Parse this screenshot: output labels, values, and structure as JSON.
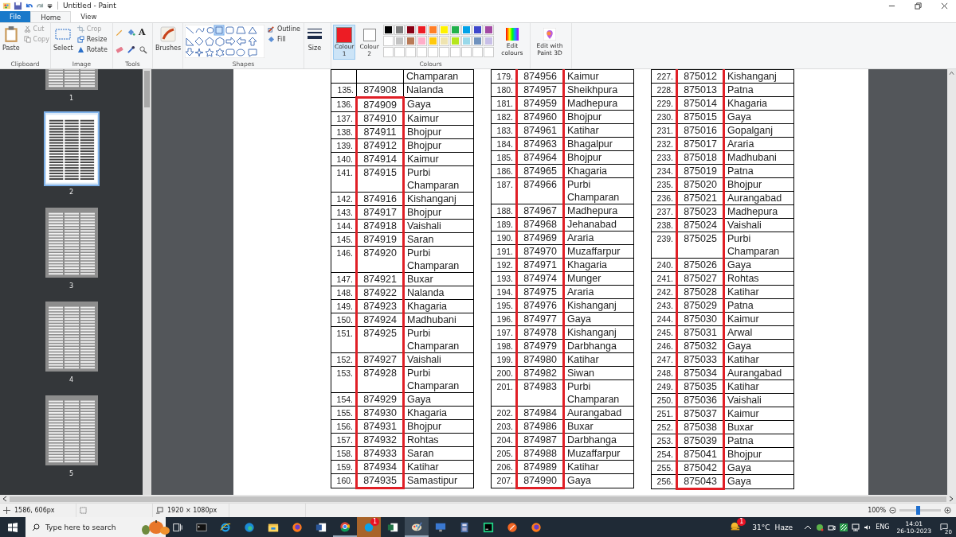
{
  "window": {
    "title": "Untitled - Paint"
  },
  "tabs": [
    {
      "label": "File",
      "selected": false,
      "kind": "file"
    },
    {
      "label": "Home",
      "selected": true,
      "kind": "tab"
    },
    {
      "label": "View",
      "selected": false,
      "kind": "tab"
    }
  ],
  "ribbon": {
    "clipboard": {
      "label": "Clipboard",
      "paste": "Paste",
      "small": [
        {
          "label": "Cut",
          "kind": "cut",
          "disabled": true
        },
        {
          "label": "Copy",
          "kind": "copy",
          "disabled": true
        }
      ]
    },
    "image": {
      "label": "Image",
      "select": "Select",
      "small": [
        {
          "label": "Crop",
          "kind": "crop",
          "disabled": true
        },
        {
          "label": "Resize",
          "kind": "resize",
          "disabled": false
        },
        {
          "label": "Rotate",
          "kind": "rotate",
          "disabled": false
        }
      ]
    },
    "tools": {
      "label": "Tools",
      "text_tool": "A"
    },
    "brushes": "Brushes",
    "shapes": {
      "label": "Shapes",
      "outline": "Outline",
      "fill": "Fill"
    },
    "size": "Size",
    "colours": {
      "label": "Colours",
      "colour1": {
        "label": "Colour 1",
        "color": "#ed1c24",
        "selected": true
      },
      "colour2": {
        "label": "Colour 2",
        "color": "#ffffff",
        "selected": false
      },
      "palette": [
        {
          "color": "#000000"
        },
        {
          "color": "#7f7f7f"
        },
        {
          "color": "#880015"
        },
        {
          "color": "#ed1c24"
        },
        {
          "color": "#ff7f27"
        },
        {
          "color": "#fff200"
        },
        {
          "color": "#22b14c"
        },
        {
          "color": "#00a2e8"
        },
        {
          "color": "#3f48cc"
        },
        {
          "color": "#a349a4"
        },
        {
          "color": "#ffffff"
        },
        {
          "color": "#c3c3c3"
        },
        {
          "color": "#b97a57"
        },
        {
          "color": "#ffaec9"
        },
        {
          "color": "#ffc90e"
        },
        {
          "color": "#efe4b0"
        },
        {
          "color": "#b5e61d"
        },
        {
          "color": "#99d9ea"
        },
        {
          "color": "#7092be"
        },
        {
          "color": "#c8bfe7"
        }
      ],
      "edit": "Edit colours"
    },
    "paint3d": "Edit with Paint 3D"
  },
  "thumbnails": [
    {
      "label": "1",
      "selected": false
    },
    {
      "label": "2",
      "selected": true
    },
    {
      "label": "3",
      "selected": false
    },
    {
      "label": "4",
      "selected": false
    },
    {
      "label": "5",
      "selected": false
    }
  ],
  "tables": [
    {
      "rows": [
        {
          "district": "Champaran",
          "marked": false
        },
        {
          "num": "135.",
          "pin": "874908",
          "district": "Nalanda",
          "marked": false
        },
        {
          "num": "136.",
          "pin": "874909",
          "district": "Gaya",
          "marked": true
        },
        {
          "num": "137.",
          "pin": "874910",
          "district": "Kaimur",
          "marked": true
        },
        {
          "num": "138.",
          "pin": "874911",
          "district": "Bhojpur",
          "marked": true
        },
        {
          "num": "139.",
          "pin": "874912",
          "district": "Bhojpur",
          "marked": true
        },
        {
          "num": "140.",
          "pin": "874914",
          "district": "Kaimur",
          "marked": true
        },
        {
          "num": "141.",
          "pin": "874915",
          "district": "Purbi Champaran",
          "marked": true
        },
        {
          "num": "142.",
          "pin": "874916",
          "district": "Kishanganj",
          "marked": true
        },
        {
          "num": "143.",
          "pin": "874917",
          "district": "Bhojpur",
          "marked": true
        },
        {
          "num": "144.",
          "pin": "874918",
          "district": "Vaishali",
          "marked": true
        },
        {
          "num": "145.",
          "pin": "874919",
          "district": "Saran",
          "marked": true
        },
        {
          "num": "146.",
          "pin": "874920",
          "district": "Purbi Champaran",
          "marked": true
        },
        {
          "num": "147.",
          "pin": "874921",
          "district": "Buxar",
          "marked": true
        },
        {
          "num": "148.",
          "pin": "874922",
          "district": "Nalanda",
          "marked": true
        },
        {
          "num": "149.",
          "pin": "874923",
          "district": "Khagaria",
          "marked": true
        },
        {
          "num": "150.",
          "pin": "874924",
          "district": "Madhubani",
          "marked": true
        },
        {
          "num": "151.",
          "pin": "874925",
          "district": "Purbi Champaran",
          "marked": true
        },
        {
          "num": "152.",
          "pin": "874927",
          "district": "Vaishali",
          "marked": true
        },
        {
          "num": "153.",
          "pin": "874928",
          "district": "Purbi Champaran",
          "marked": true
        },
        {
          "num": "154.",
          "pin": "874929",
          "district": "Gaya",
          "marked": true
        },
        {
          "num": "155.",
          "pin": "874930",
          "district": "Khagaria",
          "marked": true
        },
        {
          "num": "156.",
          "pin": "874931",
          "district": "Bhojpur",
          "marked": true
        },
        {
          "num": "157.",
          "pin": "874932",
          "district": "Rohtas",
          "marked": true
        },
        {
          "num": "158.",
          "pin": "874933",
          "district": "Saran",
          "marked": true
        },
        {
          "num": "159.",
          "pin": "874934",
          "district": "Katihar",
          "marked": true
        },
        {
          "num": "160.",
          "pin": "874935",
          "district": "Samastipur",
          "marked": true
        }
      ]
    },
    {
      "rows": [
        {
          "num": "179.",
          "pin": "874956",
          "district": "Kaimur",
          "marked": true
        },
        {
          "num": "180.",
          "pin": "874957",
          "district": "Sheikhpura",
          "marked": true
        },
        {
          "num": "181.",
          "pin": "874959",
          "district": "Madhepura",
          "marked": true
        },
        {
          "num": "182.",
          "pin": "874960",
          "district": "Bhojpur",
          "marked": true
        },
        {
          "num": "183.",
          "pin": "874961",
          "district": "Katihar",
          "marked": true
        },
        {
          "num": "184.",
          "pin": "874963",
          "district": "Bhagalpur",
          "marked": true
        },
        {
          "num": "185.",
          "pin": "874964",
          "district": "Bhojpur",
          "marked": true
        },
        {
          "num": "186.",
          "pin": "874965",
          "district": "Khagaria",
          "marked": true
        },
        {
          "num": "187.",
          "pin": "874966",
          "district": "Purbi Champaran",
          "marked": true
        },
        {
          "num": "188.",
          "pin": "874967",
          "district": "Madhepura",
          "marked": true
        },
        {
          "num": "189.",
          "pin": "874968",
          "district": "Jehanabad",
          "marked": true
        },
        {
          "num": "190.",
          "pin": "874969",
          "district": "Araria",
          "marked": true
        },
        {
          "num": "191.",
          "pin": "874970",
          "district": "Muzaffarpur",
          "marked": true
        },
        {
          "num": "192.",
          "pin": "874971",
          "district": "Khagaria",
          "marked": true
        },
        {
          "num": "193.",
          "pin": "874974",
          "district": "Munger",
          "marked": true
        },
        {
          "num": "194.",
          "pin": "874975",
          "district": "Araria",
          "marked": true
        },
        {
          "num": "195.",
          "pin": "874976",
          "district": "Kishanganj",
          "marked": true
        },
        {
          "num": "196.",
          "pin": "874977",
          "district": "Gaya",
          "marked": true
        },
        {
          "num": "197.",
          "pin": "874978",
          "district": "Kishanganj",
          "marked": true
        },
        {
          "num": "198.",
          "pin": "874979",
          "district": "Darbhanga",
          "marked": true
        },
        {
          "num": "199.",
          "pin": "874980",
          "district": "Katihar",
          "marked": true
        },
        {
          "num": "200.",
          "pin": "874982",
          "district": "Siwan",
          "marked": true
        },
        {
          "num": "201.",
          "pin": "874983",
          "district": "Purbi Champaran",
          "marked": true
        },
        {
          "num": "202.",
          "pin": "874984",
          "district": "Aurangabad",
          "marked": true
        },
        {
          "num": "203.",
          "pin": "874986",
          "district": "Buxar",
          "marked": true
        },
        {
          "num": "204.",
          "pin": "874987",
          "district": "Darbhanga",
          "marked": true
        },
        {
          "num": "205.",
          "pin": "874988",
          "district": "Muzaffarpur",
          "marked": true
        },
        {
          "num": "206.",
          "pin": "874989",
          "district": "Katihar",
          "marked": true
        },
        {
          "num": "207.",
          "pin": "874990",
          "district": "Gaya",
          "marked": true
        }
      ]
    },
    {
      "rows": [
        {
          "num": "227.",
          "pin": "875012",
          "district": "Kishanganj",
          "marked": true
        },
        {
          "num": "228.",
          "pin": "875013",
          "district": "Patna",
          "marked": true
        },
        {
          "num": "229.",
          "pin": "875014",
          "district": "Khagaria",
          "marked": true
        },
        {
          "num": "230.",
          "pin": "875015",
          "district": "Gaya",
          "marked": true
        },
        {
          "num": "231.",
          "pin": "875016",
          "district": "Gopalganj",
          "marked": true
        },
        {
          "num": "232.",
          "pin": "875017",
          "district": "Araria",
          "marked": true
        },
        {
          "num": "233.",
          "pin": "875018",
          "district": "Madhubani",
          "marked": true
        },
        {
          "num": "234.",
          "pin": "875019",
          "district": "Patna",
          "marked": true
        },
        {
          "num": "235.",
          "pin": "875020",
          "district": "Bhojpur",
          "marked": true
        },
        {
          "num": "236.",
          "pin": "875021",
          "district": "Aurangabad",
          "marked": true
        },
        {
          "num": "237.",
          "pin": "875023",
          "district": "Madhepura",
          "marked": true
        },
        {
          "num": "238.",
          "pin": "875024",
          "district": "Vaishali",
          "marked": true
        },
        {
          "num": "239.",
          "pin": "875025",
          "district": "Purbi Champaran",
          "marked": true
        },
        {
          "num": "240.",
          "pin": "875026",
          "district": "Gaya",
          "marked": true
        },
        {
          "num": "241.",
          "pin": "875027",
          "district": "Rohtas",
          "marked": true
        },
        {
          "num": "242.",
          "pin": "875028",
          "district": "Katihar",
          "marked": true
        },
        {
          "num": "243.",
          "pin": "875029",
          "district": "Patna",
          "marked": true
        },
        {
          "num": "244.",
          "pin": "875030",
          "district": "Kaimur",
          "marked": true
        },
        {
          "num": "245.",
          "pin": "875031",
          "district": "Arwal",
          "marked": true
        },
        {
          "num": "246.",
          "pin": "875032",
          "district": "Gaya",
          "marked": true
        },
        {
          "num": "247.",
          "pin": "875033",
          "district": "Katihar",
          "marked": true
        },
        {
          "num": "248.",
          "pin": "875034",
          "district": "Aurangabad",
          "marked": true
        },
        {
          "num": "249.",
          "pin": "875035",
          "district": "Katihar",
          "marked": true
        },
        {
          "num": "250.",
          "pin": "875036",
          "district": "Vaishali",
          "marked": true
        },
        {
          "num": "251.",
          "pin": "875037",
          "district": "Kaimur",
          "marked": true
        },
        {
          "num": "252.",
          "pin": "875038",
          "district": "Buxar",
          "marked": true
        },
        {
          "num": "253.",
          "pin": "875039",
          "district": "Patna",
          "marked": true
        },
        {
          "num": "254.",
          "pin": "875041",
          "district": "Bhojpur",
          "marked": true
        },
        {
          "num": "255.",
          "pin": "875042",
          "district": "Gaya",
          "marked": true
        },
        {
          "num": "256.",
          "pin": "875043",
          "district": "Gaya",
          "marked": true
        }
      ]
    }
  ],
  "status_bar": {
    "cursor": "1586, 606px",
    "canvas_size": "1920 × 1080px",
    "zoom": "100%",
    "zoom_slider": {
      "level": 0.45
    }
  },
  "taskbar": {
    "search": {
      "placeholder": "Type here to search"
    },
    "apps": [
      {
        "kind": "taskview",
        "open": false,
        "selected": false,
        "attention": false
      },
      {
        "kind": "terminal",
        "open": false,
        "selected": false,
        "attention": false
      },
      {
        "kind": "ie",
        "open": false,
        "selected": false,
        "attention": false
      },
      {
        "kind": "edge",
        "open": false,
        "selected": false,
        "attention": false
      },
      {
        "kind": "folder",
        "open": false,
        "selected": false,
        "attention": false
      },
      {
        "kind": "firefox",
        "open": false,
        "selected": false,
        "attention": false
      },
      {
        "kind": "word",
        "open": false,
        "selected": false,
        "attention": false
      },
      {
        "kind": "chrome",
        "open": true,
        "selected": false,
        "attention": false
      },
      {
        "kind": "skype",
        "open": false,
        "selected": false,
        "attention": true,
        "badge": "1"
      },
      {
        "kind": "excel",
        "open": false,
        "selected": false,
        "attention": false
      },
      {
        "kind": "paint",
        "open": true,
        "selected": true,
        "attention": false
      },
      {
        "kind": "remote",
        "open": false,
        "selected": false,
        "attention": false
      },
      {
        "kind": "calculator",
        "open": false,
        "selected": false,
        "attention": false
      },
      {
        "kind": "pycharm",
        "open": false,
        "selected": false,
        "attention": false
      },
      {
        "kind": "orange",
        "open": false,
        "selected": false,
        "attention": false
      },
      {
        "kind": "firefox",
        "open": false,
        "selected": false,
        "attention": false
      }
    ],
    "weather": {
      "badge": "1",
      "temp": "31°C",
      "condition": "Haze"
    },
    "language": "ENG",
    "time": "14:01",
    "date": "26-10-2023",
    "notifications": "20"
  }
}
